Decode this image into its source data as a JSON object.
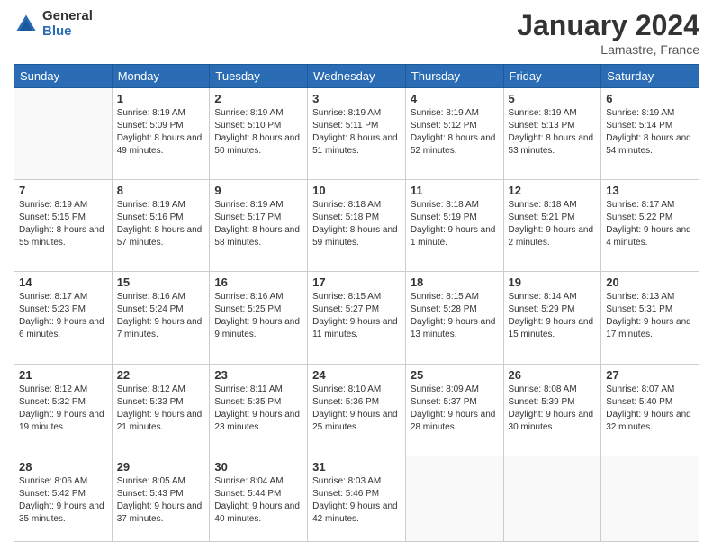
{
  "logo": {
    "general": "General",
    "blue": "Blue"
  },
  "title": "January 2024",
  "location": "Lamastre, France",
  "days_header": [
    "Sunday",
    "Monday",
    "Tuesday",
    "Wednesday",
    "Thursday",
    "Friday",
    "Saturday"
  ],
  "weeks": [
    [
      {
        "day": "",
        "sunrise": "",
        "sunset": "",
        "daylight": ""
      },
      {
        "day": "1",
        "sunrise": "Sunrise: 8:19 AM",
        "sunset": "Sunset: 5:09 PM",
        "daylight": "Daylight: 8 hours and 49 minutes."
      },
      {
        "day": "2",
        "sunrise": "Sunrise: 8:19 AM",
        "sunset": "Sunset: 5:10 PM",
        "daylight": "Daylight: 8 hours and 50 minutes."
      },
      {
        "day": "3",
        "sunrise": "Sunrise: 8:19 AM",
        "sunset": "Sunset: 5:11 PM",
        "daylight": "Daylight: 8 hours and 51 minutes."
      },
      {
        "day": "4",
        "sunrise": "Sunrise: 8:19 AM",
        "sunset": "Sunset: 5:12 PM",
        "daylight": "Daylight: 8 hours and 52 minutes."
      },
      {
        "day": "5",
        "sunrise": "Sunrise: 8:19 AM",
        "sunset": "Sunset: 5:13 PM",
        "daylight": "Daylight: 8 hours and 53 minutes."
      },
      {
        "day": "6",
        "sunrise": "Sunrise: 8:19 AM",
        "sunset": "Sunset: 5:14 PM",
        "daylight": "Daylight: 8 hours and 54 minutes."
      }
    ],
    [
      {
        "day": "7",
        "sunrise": "Sunrise: 8:19 AM",
        "sunset": "Sunset: 5:15 PM",
        "daylight": "Daylight: 8 hours and 55 minutes."
      },
      {
        "day": "8",
        "sunrise": "Sunrise: 8:19 AM",
        "sunset": "Sunset: 5:16 PM",
        "daylight": "Daylight: 8 hours and 57 minutes."
      },
      {
        "day": "9",
        "sunrise": "Sunrise: 8:19 AM",
        "sunset": "Sunset: 5:17 PM",
        "daylight": "Daylight: 8 hours and 58 minutes."
      },
      {
        "day": "10",
        "sunrise": "Sunrise: 8:18 AM",
        "sunset": "Sunset: 5:18 PM",
        "daylight": "Daylight: 8 hours and 59 minutes."
      },
      {
        "day": "11",
        "sunrise": "Sunrise: 8:18 AM",
        "sunset": "Sunset: 5:19 PM",
        "daylight": "Daylight: 9 hours and 1 minute."
      },
      {
        "day": "12",
        "sunrise": "Sunrise: 8:18 AM",
        "sunset": "Sunset: 5:21 PM",
        "daylight": "Daylight: 9 hours and 2 minutes."
      },
      {
        "day": "13",
        "sunrise": "Sunrise: 8:17 AM",
        "sunset": "Sunset: 5:22 PM",
        "daylight": "Daylight: 9 hours and 4 minutes."
      }
    ],
    [
      {
        "day": "14",
        "sunrise": "Sunrise: 8:17 AM",
        "sunset": "Sunset: 5:23 PM",
        "daylight": "Daylight: 9 hours and 6 minutes."
      },
      {
        "day": "15",
        "sunrise": "Sunrise: 8:16 AM",
        "sunset": "Sunset: 5:24 PM",
        "daylight": "Daylight: 9 hours and 7 minutes."
      },
      {
        "day": "16",
        "sunrise": "Sunrise: 8:16 AM",
        "sunset": "Sunset: 5:25 PM",
        "daylight": "Daylight: 9 hours and 9 minutes."
      },
      {
        "day": "17",
        "sunrise": "Sunrise: 8:15 AM",
        "sunset": "Sunset: 5:27 PM",
        "daylight": "Daylight: 9 hours and 11 minutes."
      },
      {
        "day": "18",
        "sunrise": "Sunrise: 8:15 AM",
        "sunset": "Sunset: 5:28 PM",
        "daylight": "Daylight: 9 hours and 13 minutes."
      },
      {
        "day": "19",
        "sunrise": "Sunrise: 8:14 AM",
        "sunset": "Sunset: 5:29 PM",
        "daylight": "Daylight: 9 hours and 15 minutes."
      },
      {
        "day": "20",
        "sunrise": "Sunrise: 8:13 AM",
        "sunset": "Sunset: 5:31 PM",
        "daylight": "Daylight: 9 hours and 17 minutes."
      }
    ],
    [
      {
        "day": "21",
        "sunrise": "Sunrise: 8:12 AM",
        "sunset": "Sunset: 5:32 PM",
        "daylight": "Daylight: 9 hours and 19 minutes."
      },
      {
        "day": "22",
        "sunrise": "Sunrise: 8:12 AM",
        "sunset": "Sunset: 5:33 PM",
        "daylight": "Daylight: 9 hours and 21 minutes."
      },
      {
        "day": "23",
        "sunrise": "Sunrise: 8:11 AM",
        "sunset": "Sunset: 5:35 PM",
        "daylight": "Daylight: 9 hours and 23 minutes."
      },
      {
        "day": "24",
        "sunrise": "Sunrise: 8:10 AM",
        "sunset": "Sunset: 5:36 PM",
        "daylight": "Daylight: 9 hours and 25 minutes."
      },
      {
        "day": "25",
        "sunrise": "Sunrise: 8:09 AM",
        "sunset": "Sunset: 5:37 PM",
        "daylight": "Daylight: 9 hours and 28 minutes."
      },
      {
        "day": "26",
        "sunrise": "Sunrise: 8:08 AM",
        "sunset": "Sunset: 5:39 PM",
        "daylight": "Daylight: 9 hours and 30 minutes."
      },
      {
        "day": "27",
        "sunrise": "Sunrise: 8:07 AM",
        "sunset": "Sunset: 5:40 PM",
        "daylight": "Daylight: 9 hours and 32 minutes."
      }
    ],
    [
      {
        "day": "28",
        "sunrise": "Sunrise: 8:06 AM",
        "sunset": "Sunset: 5:42 PM",
        "daylight": "Daylight: 9 hours and 35 minutes."
      },
      {
        "day": "29",
        "sunrise": "Sunrise: 8:05 AM",
        "sunset": "Sunset: 5:43 PM",
        "daylight": "Daylight: 9 hours and 37 minutes."
      },
      {
        "day": "30",
        "sunrise": "Sunrise: 8:04 AM",
        "sunset": "Sunset: 5:44 PM",
        "daylight": "Daylight: 9 hours and 40 minutes."
      },
      {
        "day": "31",
        "sunrise": "Sunrise: 8:03 AM",
        "sunset": "Sunset: 5:46 PM",
        "daylight": "Daylight: 9 hours and 42 minutes."
      },
      {
        "day": "",
        "sunrise": "",
        "sunset": "",
        "daylight": ""
      },
      {
        "day": "",
        "sunrise": "",
        "sunset": "",
        "daylight": ""
      },
      {
        "day": "",
        "sunrise": "",
        "sunset": "",
        "daylight": ""
      }
    ]
  ]
}
